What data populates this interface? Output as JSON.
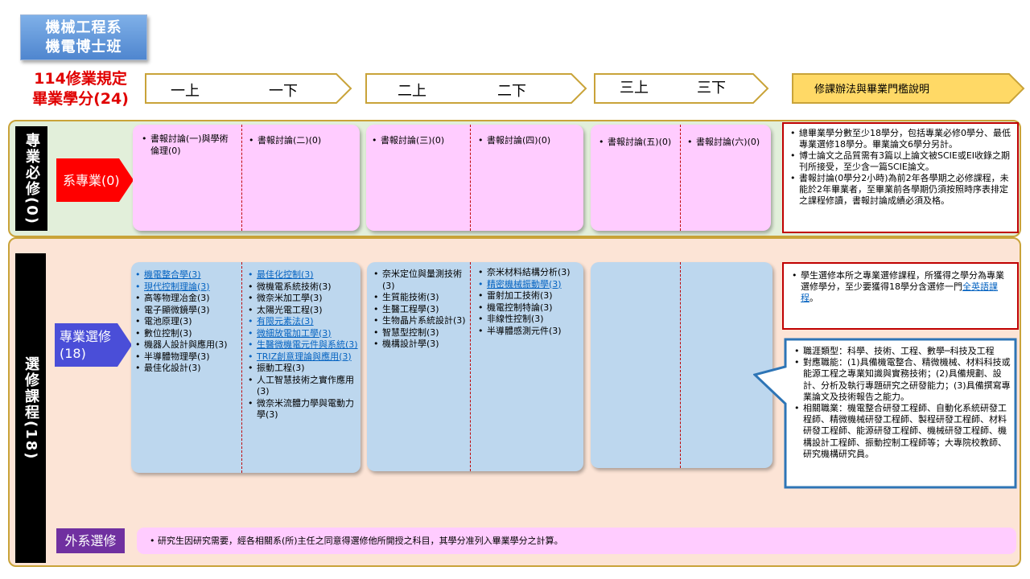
{
  "header": {
    "dept_line1": "機械工程系",
    "dept_line2": "機電博士班",
    "req_line1": "114修業規定",
    "req_line2": "畢業學分(24)"
  },
  "timeline": {
    "y1a": "一上",
    "y1b": "一下",
    "y2a": "二上",
    "y2b": "二下",
    "y3a": "三上",
    "y3b": "三下",
    "notes_header": "修課辦法與畢業門檻說明"
  },
  "required": {
    "section_label": "專業必修(0)",
    "dept_label": "系專業(0)",
    "semesters": [
      [
        "書報討論(一)與學術倫理(0)"
      ],
      [
        "書報討論(二)(0)"
      ],
      [
        "書報討論(三)(0)"
      ],
      [
        "書報討論(四)(0)"
      ],
      [
        "書報討論(五)(0)"
      ],
      [
        "書報討論(六)(0)"
      ]
    ],
    "notes": [
      "總畢業學分數至少18學分，包括專業必修0學分、最低專業選修18學分。畢業論文6學分另計。",
      "博士論文之品質需有3篇以上論文被SCIE或EI收錄之期刊所接受，至少含一篇SCIE論文。",
      "書報討論(0學分2小時)為前2年各學期之必修課程，未能於2年畢業者，至畢業前各學期仍須按照時序表排定之課程修讀，書報討論成績必須及格。"
    ]
  },
  "elective": {
    "section_label": "選修課程(18)",
    "pro_label": "專業選修(18)",
    "y1a": [
      {
        "t": "機電整合學(3)",
        "link": true
      },
      {
        "t": "現代控制理論(3)",
        "link": true
      },
      {
        "t": "高等物理冶金(3)",
        "link": false
      },
      {
        "t": "電子顯微鏡學(3)",
        "link": false
      },
      {
        "t": "電池原理(3)",
        "link": false
      },
      {
        "t": "數位控制(3)",
        "link": false
      },
      {
        "t": "機器人設計與應用(3)",
        "link": false
      },
      {
        "t": "半導體物理學(3)",
        "link": false
      },
      {
        "t": "最佳化設計(3)",
        "link": false
      }
    ],
    "y1b": [
      {
        "t": "最佳化控制(3)",
        "link": true
      },
      {
        "t": "微機電系統技術(3)",
        "link": false
      },
      {
        "t": "微奈米加工學(3)",
        "link": false
      },
      {
        "t": "太陽光電工程(3)",
        "link": false
      },
      {
        "t": "有限元素法(3)",
        "link": true
      },
      {
        "t": "微細放電加工學(3)",
        "link": true
      },
      {
        "t": "生醫微機電元件與系統(3)",
        "link": true
      },
      {
        "t": "TRIZ創意理論與應用(3)",
        "link": true
      },
      {
        "t": "振動工程(3)",
        "link": false
      },
      {
        "t": "人工智慧技術之實作應用(3)",
        "link": false
      },
      {
        "t": "微奈米流體力學與電動力學(3)",
        "link": false
      }
    ],
    "y2a": [
      {
        "t": "奈米定位與量測技術(3)",
        "link": false
      },
      {
        "t": "生質能技術(3)",
        "link": false
      },
      {
        "t": "生醫工程學(3)",
        "link": false
      },
      {
        "t": "生物晶片系統設計(3)",
        "link": false
      },
      {
        "t": "智慧型控制(3)",
        "link": false
      },
      {
        "t": "機構設計學(3)",
        "link": false
      }
    ],
    "y2b": [
      {
        "t": "奈米材料結構分析(3)",
        "link": false
      },
      {
        "t": "精密機械振動學(3)",
        "link": true
      },
      {
        "t": "雷射加工技術(3)",
        "link": false
      },
      {
        "t": "機電控制特論(3)",
        "link": false
      },
      {
        "t": "非線性控制(3)",
        "link": false
      },
      {
        "t": "半導體感測元件(3)",
        "link": false
      }
    ],
    "note_pre": "學生選修本所之專業選修課程，所獲得之學分為專業選修學分，至少要獲得18學分含選修一門",
    "note_link": "全英語課程",
    "note_post": "。",
    "career": [
      "職涯類型：科學、技術、工程、數學─科技及工程",
      "對應職能：(1)具備機電整合、精微機械、材料科技或能源工程之專業知識與實務技術；(2)具備規劃、設計、分析及執行專題研究之研發能力；(3)具備撰寫專業論文及技術報告之能力。",
      "相關職業：機電整合研發工程師、自動化系統研發工程師、精微機械研發工程師、製程研發工程師、材料研發工程師、能源研發工程師、機械研發工程師、機構設計工程師、振動控制工程師等；大專院校教師、研究機構研究員。"
    ],
    "external_label": "外系選修",
    "external_text": "研究生因研究需要，經各相關系(所)主任之同意得選修他所開授之科目，其學分准列入畢業學分之計算。"
  },
  "colors": {
    "accent_gold": "#c9a339",
    "required_bg": "#e2efda",
    "elective_bg": "#fce4d6",
    "pink_box": "#ffccff",
    "blue_box": "#bdd7ee",
    "alert_red": "#c00000",
    "purple": "#7030a0"
  }
}
